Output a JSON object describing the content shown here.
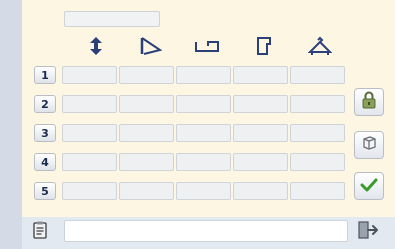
{
  "title_field": {
    "value": ""
  },
  "header_icons": [
    {
      "icon": "vertical-arrows-icon"
    },
    {
      "icon": "angle-profile-icon"
    },
    {
      "icon": "bracket-profile-icon"
    },
    {
      "icon": "hook-profile-icon"
    },
    {
      "icon": "hanger-icon"
    }
  ],
  "rows": [
    {
      "label": "1",
      "cells": [
        "",
        "",
        "",
        "",
        ""
      ]
    },
    {
      "label": "2",
      "cells": [
        "",
        "",
        "",
        "",
        ""
      ]
    },
    {
      "label": "3",
      "cells": [
        "",
        "",
        "",
        "",
        ""
      ]
    },
    {
      "label": "4",
      "cells": [
        "",
        "",
        "",
        "",
        ""
      ]
    },
    {
      "label": "5",
      "cells": [
        "",
        "",
        "",
        "",
        ""
      ]
    }
  ],
  "side_buttons": [
    {
      "icon": "lock-icon"
    },
    {
      "icon": "cube-icon"
    },
    {
      "icon": "checkmark-icon"
    }
  ],
  "bottom": {
    "doc_icon": "clipboard-icon",
    "status_value": "",
    "exit_icon": "exit-door-icon"
  },
  "colors": {
    "panel_bg": "#fdf6e2",
    "row_label": "#1a2b4d",
    "check_green": "#3a9a2b"
  }
}
